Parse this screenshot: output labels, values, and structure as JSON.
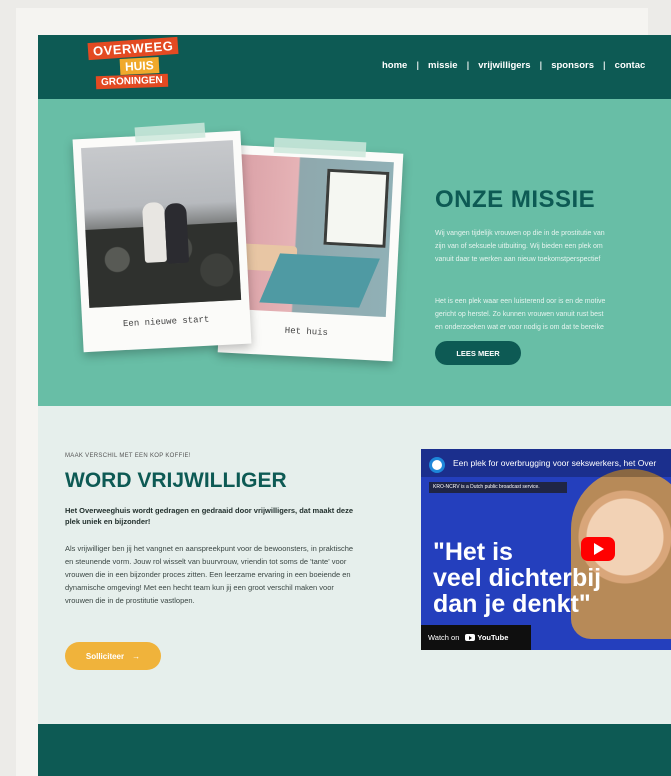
{
  "logo": {
    "line1": "OVERWEEG",
    "line2": "HUIS",
    "line3": "GRONINGEN"
  },
  "nav": {
    "items": [
      "home",
      "missie",
      "vrijwilligers",
      "sponsors",
      "contac"
    ],
    "separator": "|"
  },
  "mission": {
    "title": "ONZE MISSIE",
    "para1": [
      "Wij vangen tijdelijk vrouwen op die in de prostitutie van",
      "zijn van of seksuele uitbuiting. Wij bieden een plek om",
      "vanuit daar te werken aan nieuw toekomstperspectief"
    ],
    "para2": [
      "Het is een plek waar een luisterend oor is en de motive",
      "gericht op herstel. Zo kunnen vrouwen vanuit rust best",
      "en onderzoeken wat er voor nodig is om dat te bereike"
    ],
    "button": "LEES MEER",
    "photo1_caption": "Een nieuwe start",
    "photo2_caption": "Het huis"
  },
  "volunteer": {
    "eyebrow": "MAAK VERSCHIL MET EEN KOP KOFFIE!",
    "title": "WORD VRIJWILLIGER",
    "lead": "Het Overweeghuis wordt gedragen en gedraaid door vrijwilligers, dat maakt deze plek uniek en bijzonder!",
    "body": "Als vrijwilliger ben jij het vangnet en aanspreekpunt voor de bewoonsters, in praktische en steunende vorm. Jouw rol wisselt van buurvrouw, vriendin tot soms de 'tante' voor vrouwen die in een bijzonder proces zitten. Een leerzame ervaring in een boeiende en dynamische omgeving! Met een hecht team kun jij een groot verschil maken voor vrouwen die in de prostitutie vastlopen.",
    "button": "Solliciteer",
    "button_arrow": "→"
  },
  "video": {
    "title": "Een plek for overbrugging voor sekswerkers, het Over",
    "notice": "KRO-NCRV is a Dutch public broadcast service.",
    "overlay_line1": "\"Het is",
    "overlay_line2": "veel dichterbij",
    "overlay_line3": "dan je denkt\"",
    "watch_on": "Watch on",
    "youtube": "YouTube"
  },
  "colors": {
    "primary": "#0d5a54",
    "mint": "#68bea6",
    "accent_orange": "#e34a22",
    "accent_yellow": "#f0b33b"
  }
}
